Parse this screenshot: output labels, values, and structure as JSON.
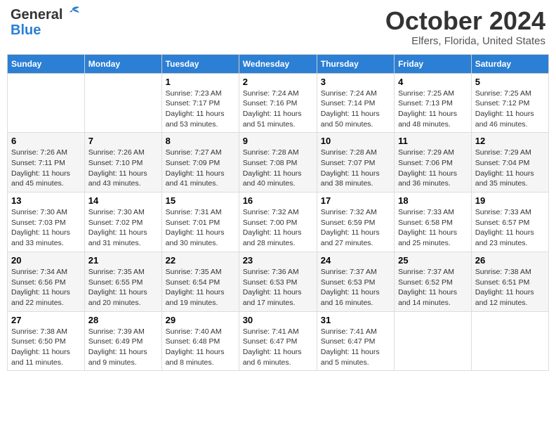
{
  "header": {
    "logo_general": "General",
    "logo_blue": "Blue",
    "month": "October 2024",
    "location": "Elfers, Florida, United States"
  },
  "weekdays": [
    "Sunday",
    "Monday",
    "Tuesday",
    "Wednesday",
    "Thursday",
    "Friday",
    "Saturday"
  ],
  "weeks": [
    [
      {
        "day": "",
        "detail": ""
      },
      {
        "day": "",
        "detail": ""
      },
      {
        "day": "1",
        "detail": "Sunrise: 7:23 AM\nSunset: 7:17 PM\nDaylight: 11 hours and 53 minutes."
      },
      {
        "day": "2",
        "detail": "Sunrise: 7:24 AM\nSunset: 7:16 PM\nDaylight: 11 hours and 51 minutes."
      },
      {
        "day": "3",
        "detail": "Sunrise: 7:24 AM\nSunset: 7:14 PM\nDaylight: 11 hours and 50 minutes."
      },
      {
        "day": "4",
        "detail": "Sunrise: 7:25 AM\nSunset: 7:13 PM\nDaylight: 11 hours and 48 minutes."
      },
      {
        "day": "5",
        "detail": "Sunrise: 7:25 AM\nSunset: 7:12 PM\nDaylight: 11 hours and 46 minutes."
      }
    ],
    [
      {
        "day": "6",
        "detail": "Sunrise: 7:26 AM\nSunset: 7:11 PM\nDaylight: 11 hours and 45 minutes."
      },
      {
        "day": "7",
        "detail": "Sunrise: 7:26 AM\nSunset: 7:10 PM\nDaylight: 11 hours and 43 minutes."
      },
      {
        "day": "8",
        "detail": "Sunrise: 7:27 AM\nSunset: 7:09 PM\nDaylight: 11 hours and 41 minutes."
      },
      {
        "day": "9",
        "detail": "Sunrise: 7:28 AM\nSunset: 7:08 PM\nDaylight: 11 hours and 40 minutes."
      },
      {
        "day": "10",
        "detail": "Sunrise: 7:28 AM\nSunset: 7:07 PM\nDaylight: 11 hours and 38 minutes."
      },
      {
        "day": "11",
        "detail": "Sunrise: 7:29 AM\nSunset: 7:06 PM\nDaylight: 11 hours and 36 minutes."
      },
      {
        "day": "12",
        "detail": "Sunrise: 7:29 AM\nSunset: 7:04 PM\nDaylight: 11 hours and 35 minutes."
      }
    ],
    [
      {
        "day": "13",
        "detail": "Sunrise: 7:30 AM\nSunset: 7:03 PM\nDaylight: 11 hours and 33 minutes."
      },
      {
        "day": "14",
        "detail": "Sunrise: 7:30 AM\nSunset: 7:02 PM\nDaylight: 11 hours and 31 minutes."
      },
      {
        "day": "15",
        "detail": "Sunrise: 7:31 AM\nSunset: 7:01 PM\nDaylight: 11 hours and 30 minutes."
      },
      {
        "day": "16",
        "detail": "Sunrise: 7:32 AM\nSunset: 7:00 PM\nDaylight: 11 hours and 28 minutes."
      },
      {
        "day": "17",
        "detail": "Sunrise: 7:32 AM\nSunset: 6:59 PM\nDaylight: 11 hours and 27 minutes."
      },
      {
        "day": "18",
        "detail": "Sunrise: 7:33 AM\nSunset: 6:58 PM\nDaylight: 11 hours and 25 minutes."
      },
      {
        "day": "19",
        "detail": "Sunrise: 7:33 AM\nSunset: 6:57 PM\nDaylight: 11 hours and 23 minutes."
      }
    ],
    [
      {
        "day": "20",
        "detail": "Sunrise: 7:34 AM\nSunset: 6:56 PM\nDaylight: 11 hours and 22 minutes."
      },
      {
        "day": "21",
        "detail": "Sunrise: 7:35 AM\nSunset: 6:55 PM\nDaylight: 11 hours and 20 minutes."
      },
      {
        "day": "22",
        "detail": "Sunrise: 7:35 AM\nSunset: 6:54 PM\nDaylight: 11 hours and 19 minutes."
      },
      {
        "day": "23",
        "detail": "Sunrise: 7:36 AM\nSunset: 6:53 PM\nDaylight: 11 hours and 17 minutes."
      },
      {
        "day": "24",
        "detail": "Sunrise: 7:37 AM\nSunset: 6:53 PM\nDaylight: 11 hours and 16 minutes."
      },
      {
        "day": "25",
        "detail": "Sunrise: 7:37 AM\nSunset: 6:52 PM\nDaylight: 11 hours and 14 minutes."
      },
      {
        "day": "26",
        "detail": "Sunrise: 7:38 AM\nSunset: 6:51 PM\nDaylight: 11 hours and 12 minutes."
      }
    ],
    [
      {
        "day": "27",
        "detail": "Sunrise: 7:38 AM\nSunset: 6:50 PM\nDaylight: 11 hours and 11 minutes."
      },
      {
        "day": "28",
        "detail": "Sunrise: 7:39 AM\nSunset: 6:49 PM\nDaylight: 11 hours and 9 minutes."
      },
      {
        "day": "29",
        "detail": "Sunrise: 7:40 AM\nSunset: 6:48 PM\nDaylight: 11 hours and 8 minutes."
      },
      {
        "day": "30",
        "detail": "Sunrise: 7:41 AM\nSunset: 6:47 PM\nDaylight: 11 hours and 6 minutes."
      },
      {
        "day": "31",
        "detail": "Sunrise: 7:41 AM\nSunset: 6:47 PM\nDaylight: 11 hours and 5 minutes."
      },
      {
        "day": "",
        "detail": ""
      },
      {
        "day": "",
        "detail": ""
      }
    ]
  ]
}
